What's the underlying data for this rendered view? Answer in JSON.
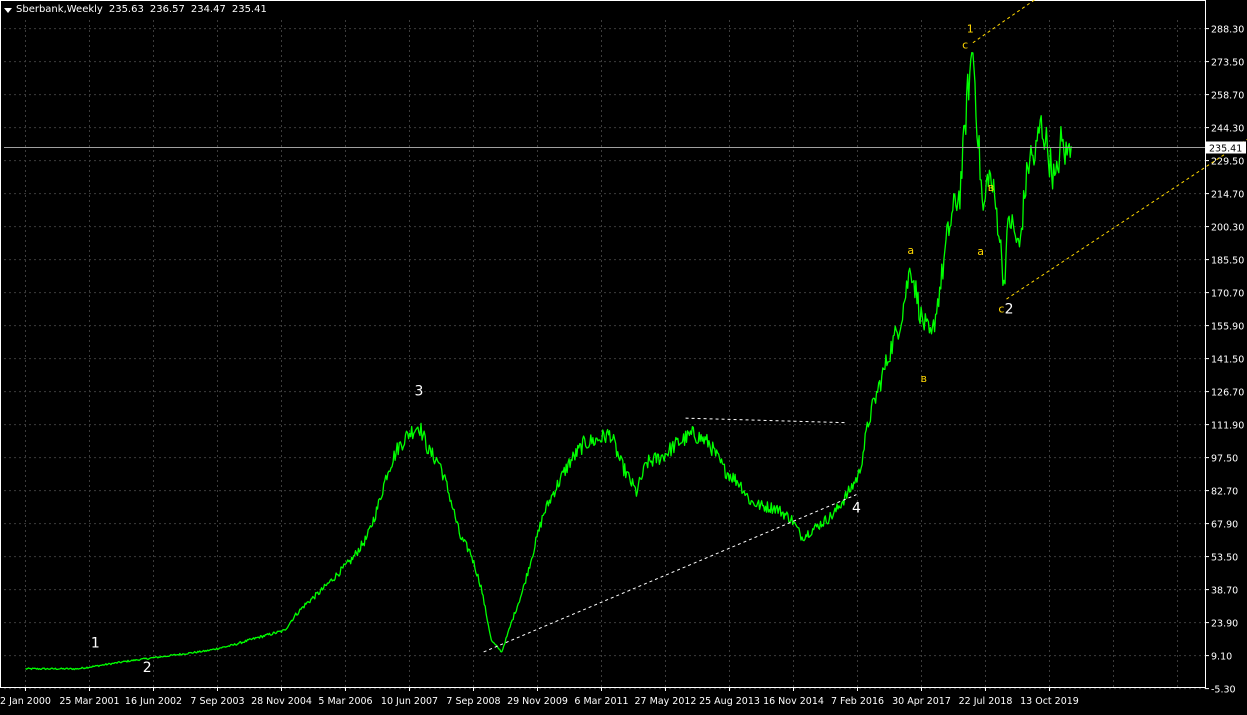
{
  "header": {
    "symbol": "Sberbank,Weekly",
    "open": "235.63",
    "high": "236.57",
    "low": "234.47",
    "close": "235.41"
  },
  "colors": {
    "background": "#000000",
    "price": "#00ff00",
    "grid": "#3c3c3c",
    "text": "#ffffff",
    "wave_primary": "#ffffff",
    "wave_minor": "#ffd700"
  },
  "chart_data": {
    "type": "line",
    "title": "",
    "xlabel": "",
    "ylabel": "",
    "grid": true,
    "ylim": [
      -5.3,
      288.3
    ],
    "y_ticks": [
      "288.30",
      "273.50",
      "258.70",
      "244.30",
      "229.50",
      "214.70",
      "200.30",
      "185.50",
      "170.70",
      "155.90",
      "141.50",
      "126.70",
      "111.90",
      "97.50",
      "82.70",
      "67.90",
      "53.50",
      "38.70",
      "23.90",
      "9.10",
      "-5.30"
    ],
    "x_ticks": [
      "2 Jan 2000",
      "25 Mar 2001",
      "16 Jun 2002",
      "7 Sep 2003",
      "28 Nov 2004",
      "5 Mar 2006",
      "10 Jun 2007",
      "7 Sep 2008",
      "29 Nov 2009",
      "6 Mar 2011",
      "27 May 2012",
      "25 Aug 2013",
      "16 Nov 2014",
      "7 Feb 2016",
      "30 Apr 2017",
      "22 Jul 2018",
      "13 Oct 2019"
    ],
    "current_price_label": "235.41",
    "current_price": 235.41,
    "series": [
      {
        "x": [
          2000.0,
          2001.0,
          2001.3,
          2002.0,
          2002.5,
          2003.0,
          2003.5,
          2004.0,
          2004.5,
          2005.0,
          2005.2,
          2005.4,
          2005.7,
          2006.0,
          2006.3,
          2006.6,
          2006.8,
          2007.0,
          2007.2,
          2007.4,
          2007.6,
          2007.8,
          2008.0,
          2008.2,
          2008.4,
          2008.6,
          2008.8,
          2009.0,
          2009.2,
          2009.4,
          2009.6,
          2009.8,
          2010.0,
          2010.2,
          2010.5,
          2010.8,
          2011.0,
          2011.3,
          2011.5,
          2011.8,
          2012.0,
          2012.3,
          2012.6,
          2012.9,
          2013.2,
          2013.5,
          2013.8,
          2014.0,
          2014.2,
          2014.5,
          2014.8,
          2015.0,
          2015.3,
          2015.6,
          2015.9,
          2016.1,
          2016.3,
          2016.5,
          2016.7,
          2016.9,
          2017.1,
          2017.3,
          2017.5,
          2017.7,
          2017.8,
          2017.95,
          2018.05,
          2018.2,
          2018.3,
          2018.4,
          2018.5,
          2018.6,
          2018.7,
          2018.8,
          2018.9,
          2019.0,
          2019.2,
          2019.3,
          2019.4,
          2019.5,
          2019.6,
          2019.7,
          2019.8,
          2019.9,
          2020.0,
          2020.1,
          2020.2
        ],
        "y": [
          3.5,
          3.5,
          4.5,
          7.0,
          8.5,
          10.0,
          11.5,
          14.0,
          17.5,
          20.5,
          27.0,
          32.0,
          38.0,
          45.0,
          52.0,
          62.0,
          75.0,
          92.0,
          102.0,
          108.0,
          112.0,
          100.0,
          95.0,
          80.0,
          62.0,
          55.0,
          40.0,
          16.0,
          11.0,
          25.0,
          38.0,
          55.0,
          72.0,
          82.0,
          95.0,
          104.0,
          105.0,
          108.0,
          95.0,
          82.0,
          95.0,
          98.0,
          104.0,
          108.0,
          104.0,
          92.0,
          86.0,
          78.0,
          76.0,
          75.0,
          70.0,
          62.0,
          67.0,
          72.0,
          82.0,
          90.0,
          115.0,
          130.0,
          145.0,
          158.0,
          183.0,
          160.0,
          150.0,
          178.0,
          195.0,
          210.0,
          215.0,
          260.0,
          280.0,
          240.0,
          205.0,
          225.0,
          215.0,
          200.0,
          175.0,
          205.0,
          190.0,
          215.0,
          232.0,
          230.0,
          246.0,
          240.0,
          228.0,
          219.0,
          238.0,
          232.0,
          236.0
        ]
      }
    ],
    "trendlines": [
      {
        "x": [
          2008.85,
          2016.05
        ],
        "y": [
          11.0,
          81.0
        ]
      },
      {
        "x": [
          2012.75,
          2015.85
        ],
        "y": [
          115.0,
          113.0
        ]
      },
      {
        "x": [
          2018.95,
          2025.3
        ],
        "y": [
          168.0,
          265.0
        ]
      },
      {
        "x": [
          2018.3,
          2019.55
        ],
        "y": [
          282.0,
          302.0
        ]
      }
    ],
    "annotations": [
      {
        "text": "1",
        "x": 2001.35,
        "y": 13.0,
        "color": "wave_primary",
        "size": 14
      },
      {
        "text": "2",
        "x": 2002.35,
        "y": 2.0,
        "color": "wave_primary",
        "size": 14
      },
      {
        "text": "3",
        "x": 2007.6,
        "y": 125.0,
        "color": "wave_primary",
        "size": 14
      },
      {
        "text": "4",
        "x": 2016.05,
        "y": 73.0,
        "color": "wave_primary",
        "size": 14
      },
      {
        "text": "a",
        "x": 2017.1,
        "y": 188.0,
        "color": "wave_minor",
        "size": 11
      },
      {
        "text": "в",
        "x": 2017.35,
        "y": 131.0,
        "color": "wave_minor",
        "size": 11
      },
      {
        "text": "c",
        "x": 2018.15,
        "y": 279.5,
        "color": "wave_minor",
        "size": 11
      },
      {
        "text": "1",
        "x": 2018.25,
        "y": 286.5,
        "color": "wave_minor",
        "size": 11
      },
      {
        "text": "a",
        "x": 2018.45,
        "y": 187.5,
        "color": "wave_minor",
        "size": 11
      },
      {
        "text": "в",
        "x": 2018.65,
        "y": 216.0,
        "color": "wave_minor",
        "size": 11
      },
      {
        "text": "c",
        "x": 2018.85,
        "y": 162.0,
        "color": "wave_minor",
        "size": 11
      },
      {
        "text": "2",
        "x": 2019.0,
        "y": 161.5,
        "color": "wave_primary",
        "size": 14
      }
    ]
  }
}
